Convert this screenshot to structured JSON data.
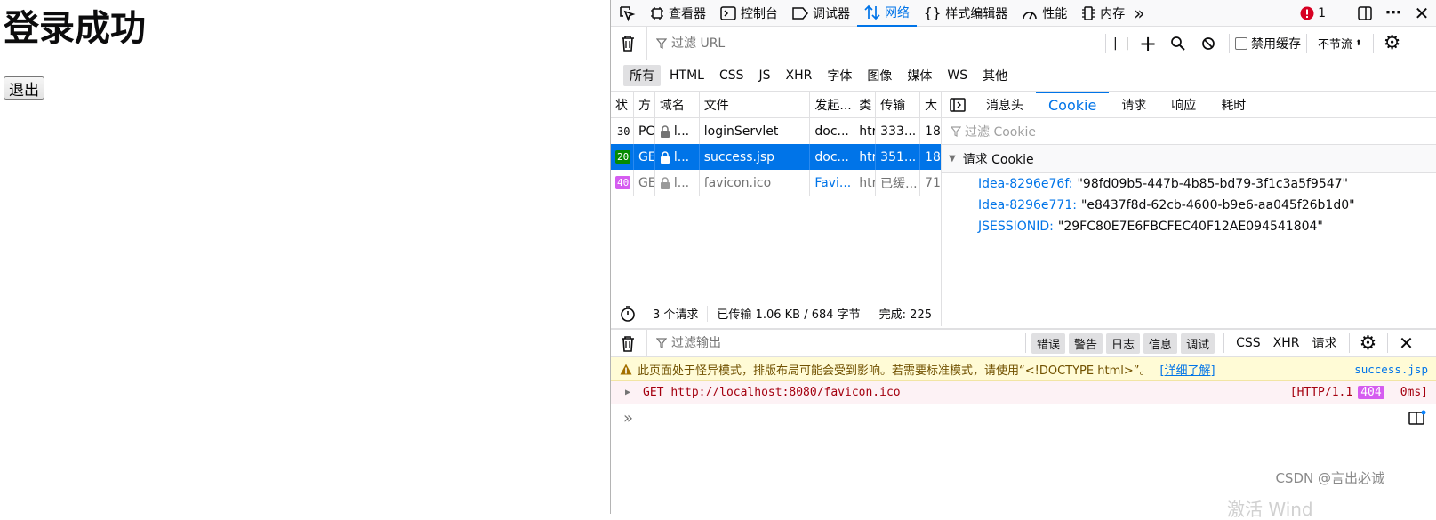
{
  "page": {
    "title": "登录成功",
    "logout_label": "退出"
  },
  "toolbox": {
    "tools": [
      {
        "label": "查看器",
        "icon": "inspector-icon"
      },
      {
        "label": "控制台",
        "icon": "console-icon"
      },
      {
        "label": "调试器",
        "icon": "debugger-icon"
      },
      {
        "label": "网络",
        "icon": "network-icon",
        "active": true
      },
      {
        "label": "样式编辑器",
        "icon": "style-editor-icon"
      },
      {
        "label": "性能",
        "icon": "performance-icon"
      },
      {
        "label": "内存",
        "icon": "memory-icon"
      }
    ],
    "error_count": "1"
  },
  "network": {
    "url_filter_placeholder": "过滤 URL",
    "disable_cache_label": "禁用缓存",
    "throttle_label": "不节流",
    "type_filters": [
      "所有",
      "HTML",
      "CSS",
      "JS",
      "XHR",
      "字体",
      "图像",
      "媒体",
      "WS",
      "其他"
    ],
    "columns": [
      "状",
      "方",
      "域名",
      "文件",
      "发起...",
      "类",
      "传输",
      "大"
    ],
    "requests": [
      {
        "status": "30",
        "method": "PC",
        "domain": "l...",
        "file": "loginServlet",
        "initiator": "doc...",
        "type": "htr",
        "transfer": "333...",
        "size": "18"
      },
      {
        "status": "20",
        "method": "GE",
        "domain": "l...",
        "file": "success.jsp",
        "initiator": "doc...",
        "type": "htr",
        "transfer": "351...",
        "size": "18"
      },
      {
        "status": "40",
        "method": "GE",
        "domain": "l...",
        "file": "favicon.ico",
        "initiator": "Favi...",
        "type": "htr",
        "transfer": "已缓...",
        "size": "71"
      }
    ],
    "status_colors": {
      "30": "#ffffff",
      "20": "#058b00",
      "40": "#d55cf0"
    },
    "summary": {
      "count": "3 个请求",
      "transferred": "已传输 1.06 KB / 684 字节",
      "finish": "完成: 225"
    }
  },
  "sidepanel": {
    "tabs": [
      "消息头",
      "Cookie",
      "请求",
      "响应",
      "耗时"
    ],
    "cookie_filter_placeholder": "过滤 Cookie",
    "section_title": "请求 Cookie",
    "cookies": [
      {
        "name": "Idea-8296e76f:",
        "value": "\"98fd09b5-447b-4b85-bd79-3f1c3a5f9547\""
      },
      {
        "name": "Idea-8296e771:",
        "value": "\"e8437f8d-62cb-4600-b9e6-aa045f26b1d0\""
      },
      {
        "name": "JSESSIONID:",
        "value": "\"29FC80E7E6FBCFEC40F12AE094541804\""
      }
    ]
  },
  "console": {
    "filter_placeholder": "过滤输出",
    "level_buttons": [
      "错误",
      "警告",
      "日志",
      "信息",
      "调试"
    ],
    "category_buttons": [
      "CSS",
      "XHR",
      "请求"
    ],
    "warning": {
      "text": "此页面处于怪异模式，排版布局可能会受到影响。若需要标准模式，请使用“<!DOCTYPE html>”。",
      "link": "[详细了解]",
      "source": "success.jsp"
    },
    "error": {
      "text": "GET http://localhost:8080/favicon.ico",
      "protocol": "[HTTP/1.1",
      "code": "404",
      "time": "0ms]"
    }
  },
  "watermark": "CSDN @言出必诚",
  "activate_text": "激活 Wind"
}
